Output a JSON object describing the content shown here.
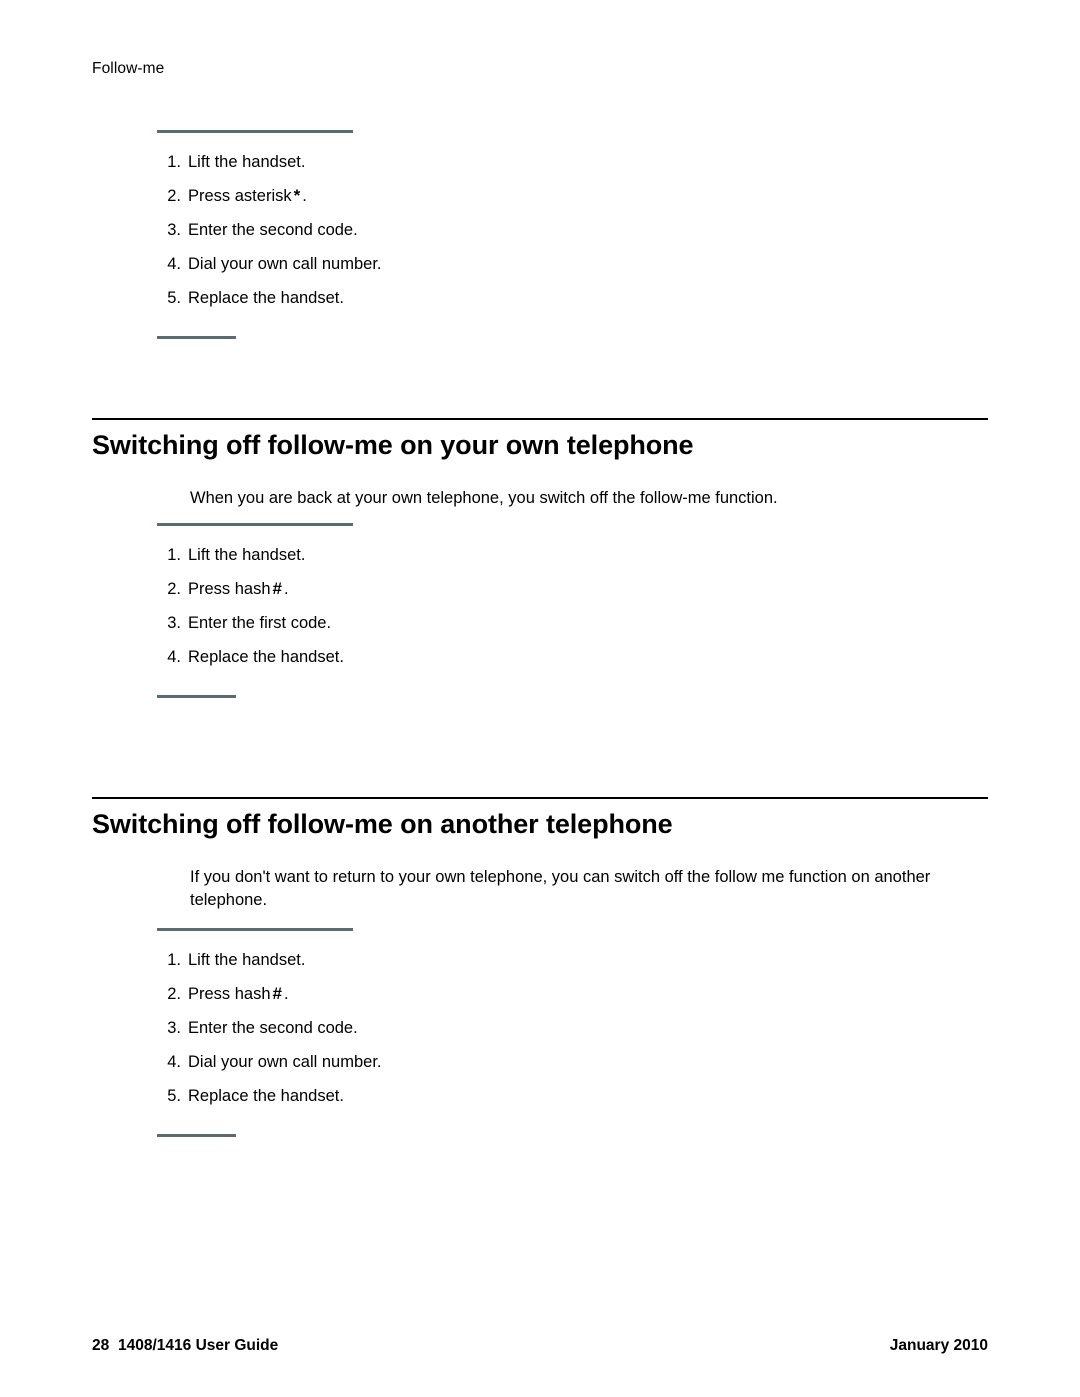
{
  "header": {
    "running_head": "Follow-me"
  },
  "blocks": [
    {
      "kind": "procedure",
      "steps": [
        {
          "num": "1.",
          "text": "Lift the handset.",
          "key": null,
          "after": null
        },
        {
          "num": "2.",
          "text": "Press asterisk",
          "key": "*",
          "after": "."
        },
        {
          "num": "3.",
          "text": "Enter the second code.",
          "key": null,
          "after": null
        },
        {
          "num": "4.",
          "text": "Dial your own call number.",
          "key": null,
          "after": null
        },
        {
          "num": "5.",
          "text": "Replace the handset.",
          "key": null,
          "after": null
        }
      ]
    },
    {
      "kind": "section",
      "title": "Switching off follow-me on your own telephone",
      "paragraph": "When you are back at your own telephone, you switch off the follow-me function.",
      "steps": [
        {
          "num": "1.",
          "text": "Lift the handset.",
          "key": null,
          "after": null
        },
        {
          "num": "2.",
          "text": "Press hash",
          "key": "#",
          "after": "."
        },
        {
          "num": "3.",
          "text": "Enter the first code.",
          "key": null,
          "after": null
        },
        {
          "num": "4.",
          "text": "Replace the handset.",
          "key": null,
          "after": null
        }
      ]
    },
    {
      "kind": "section",
      "title": "Switching off follow-me on another telephone",
      "paragraph": "If you don't want to return to your own telephone, you can switch off the follow me function on another telephone.",
      "steps": [
        {
          "num": "1.",
          "text": "Lift the handset.",
          "key": null,
          "after": null
        },
        {
          "num": "2.",
          "text": "Press hash",
          "key": "#",
          "after": "."
        },
        {
          "num": "3.",
          "text": "Enter the second code.",
          "key": null,
          "after": null
        },
        {
          "num": "4.",
          "text": "Dial your own call number.",
          "key": null,
          "after": null
        },
        {
          "num": "5.",
          "text": "Replace the handset.",
          "key": null,
          "after": null
        }
      ]
    }
  ],
  "footer": {
    "page_number": "28",
    "document_title": "1408/1416 User Guide",
    "date": "January 2010"
  }
}
